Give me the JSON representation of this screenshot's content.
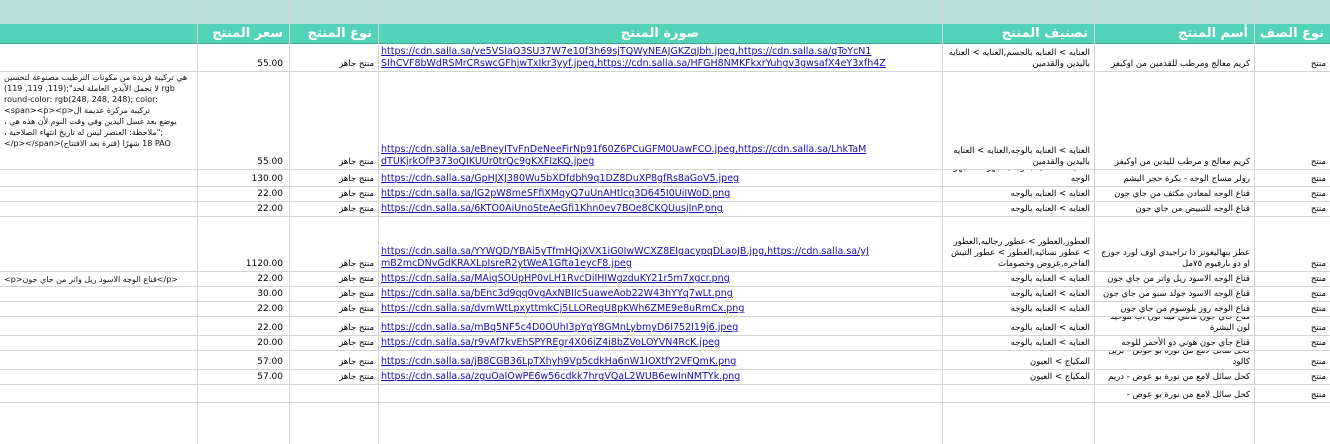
{
  "sheet": {
    "headers": {
      "row_type": "نوع الصف",
      "product_name": "أسم المنتج",
      "category": "تصنيف المنتج",
      "image": "صورة المنتج",
      "product_type": "نوع المنتج",
      "price": "سعر المنتج"
    },
    "rows": [
      {
        "row_type": "منتج",
        "name": "كريم معالج ومرطب للقدمين من اوكيفز",
        "category": "العنايه > العنايه بالجسم,العنايه > العنايه باليدين والقدمين",
        "urls": [
          "https://cdn.salla.sa/ve5VSIaO3SU37W7e10f3h69sjTQWyNEAJGKZqJbh.jpeg,https://cdn.salla.sa/qToYcN1",
          "SIhCVF8bWdRSMrCRswcGFhjwTxIkr3yyf.jpeg,https://cdn.salla.sa/HFGH8NMKFkxrYuhgv3gwsafX4eY3xfh4Z"
        ],
        "type": "منتج جاهز",
        "price": "55.00",
        "desc": []
      },
      {
        "row_type": "منتج",
        "name": "كريم معالج و مرطب لليدين من اوكيفز",
        "category": "العنايه > العنايه بالوجه,العنايه > العنايه باليدين والقدمين",
        "urls": [
          "https://cdn.salla.sa/eBneyITvFnDeNeeFirNp91f60Z6PCuGFM0UawFCO.jpeg,https://cdn.salla.sa/LhkTaM",
          "dTUKjrkOfP373oQIKUUr0trQc9gKXFIzKQ.jpeg"
        ],
        "type": "منتج جاهز",
        "price": "55.00",
        "desc": [
          "هي تركيبة فريدة من مكونات الترطيب مصنوعة لتحسين",
          "لا تحمل الأيدي العاملة لحد\";(119, 119, 119) rgb",
          "round-color: rgb(248, 248, 248); color:",
          "<span><p><p>تركيبة مركزة عديمة ال",
          "، يوضع بعد غسل اليدين وفي وقت النوم لأن هذه هي",
          "، ملاحظة: العنصر ليس له تاريخ انتهاء الصلاحية\";",
          "</p></span>(فترة بعد الافتتاح) 18 شهرًا PAO"
        ]
      },
      {
        "row_type": "منتج",
        "name": "رولر مساج الوجه - بكرة حجر اليشم",
        "category": "العنايه > العنايه بالوجه,الاجهزة > اجهزة الوجه",
        "urls": [
          "https://cdn.salla.sa/GpHJXJ380Wu5bXDfdbh9q1DZ8DuXP8gfRs8aGoV5.jpeg"
        ],
        "type": "منتج جاهز",
        "price": "130.00",
        "desc": []
      },
      {
        "row_type": "منتج",
        "name": "قناع الوجه لمعادن مكثف من جاي جون",
        "category": "العنايه > العنايه بالوجه",
        "urls": [
          "https://cdn.salla.sa/lG2pW8meSFfiXMqyQ7uUnAHtlcq3D645I0UiIWoD.png"
        ],
        "type": "منتج جاهز",
        "price": "22.00",
        "desc": []
      },
      {
        "row_type": "منتج",
        "name": "قناع الوجه للتبييض من جاي جون",
        "category": "العنايه > العنايه بالوجه",
        "urls": [
          "https://cdn.salla.sa/6KTO0AiUnoSteAeGfi1Khn0ev7BOe8CKQUusjInP.png"
        ],
        "type": "منتج جاهز",
        "price": "22.00",
        "desc": []
      },
      {
        "row_type": "منتج",
        "name": "عطر بنهاليغونز ذا تراجيدي اوف لورد جورج او دو بارفيوم ٧٥مل",
        "category": "العطور,العطور > عطور رجاليه,العطور > عطور نسائيه,العطور > عطور النيش الفاخره,عروض وخصومات",
        "urls": [
          "https://cdn.salla.sa/YYWQD/YBAi5yTfmHQjXVX1iG0IwWCXZ8EIgacypqDLaoJB.jpg,https://cdn.salla.sa/yJ",
          "mB2mcDNvGdKRAXLpIsreR2ytWeA1Gfta1eycF8.jpeg"
        ],
        "type": "منتج جاهز",
        "price": "1120.00",
        "desc": []
      },
      {
        "row_type": "منتج",
        "name": "قناع الوجه الاسود ريل واتر من جاي جون",
        "category": "العنايه > العنايه بالوجه",
        "urls": [
          "https://cdn.salla.sa/MAiqSOUpHP0vLH1RvcDiIHIWgzduKY21r5m7xgcr.png"
        ],
        "type": "منتج جاهز",
        "price": "22.00",
        "desc": [
          "<p>قناع الوجه الاسود ريل واتر من جاي جون</p>"
        ]
      },
      {
        "row_type": "منتج",
        "name": "قناع الوجه الاسود جولد سنو من جاي جون",
        "category": "العنايه > العنايه بالوجه",
        "urls": [
          "https://cdn.salla.sa/bEnc3d9qq0vgAxNBIIcSuaweAob22W43hYYq7wLt.png"
        ],
        "type": "منتج جاهز",
        "price": "30.00",
        "desc": []
      },
      {
        "row_type": "منتج",
        "name": "قناع الوجه روز بلوسوم من جاي جون",
        "category": "العنايه > العنايه بالوجه",
        "urls": [
          "https://cdn.salla.sa/dvmWtLpxyttmkCj5LLOReqU8pKWh6ZME9e8uRmCx.png"
        ],
        "type": "منتج جاهز",
        "price": "22.00",
        "desc": []
      },
      {
        "row_type": "منتج",
        "name": "قناع جاي جون مالتي فيتا تون اب لتوحيد لون البشرة",
        "category": "العنايه > العنايه بالوجه",
        "urls": [
          "https://cdn.salla.sa/mBq5NF5c4D0OUhI3pYqY8GMnLybmyD6I752I19j6.jpeg"
        ],
        "type": "منتج جاهز",
        "price": "22.00",
        "desc": []
      },
      {
        "row_type": "منتج",
        "name": "قناع جاي جون هوني دو الأحمر للوجه",
        "category": "العنايه > العنايه بالوجه",
        "urls": [
          "https://cdn.salla.sa/r9vAf7kvEhSPYREgr4X06iZ4i8bZVoLOYVN4RcK.jpeg"
        ],
        "type": "منتج جاهز",
        "price": "20.00",
        "desc": []
      },
      {
        "row_type": "منتج",
        "name": "كحل سائل لامع من نورة بو عوض - بربل كالود",
        "category": "المكياج > العيون",
        "urls": [
          "https://cdn.salla.sa/jB8CGB36LpTXhyh9Vp5cdkHa6nW1IOXtfY2VFQmK.png"
        ],
        "type": "منتج جاهز",
        "price": "57.00",
        "desc": []
      },
      {
        "row_type": "منتج",
        "name": "كحل سائل لامع من نورة بو عوض - دريم",
        "category": "المكياج > العيون",
        "urls": [
          "https://cdn.salla.sa/zguOaIOwPE6w56cdkk7hrgVQaL2WUB6ewInNMTYk.png"
        ],
        "type": "منتج جاهز",
        "price": "57.00",
        "desc": []
      },
      {
        "row_type": "منتج",
        "name": "كحل سائل لامع من نورة بو عوض -",
        "category": "",
        "urls": [],
        "type": "",
        "price": "",
        "desc": []
      }
    ]
  }
}
